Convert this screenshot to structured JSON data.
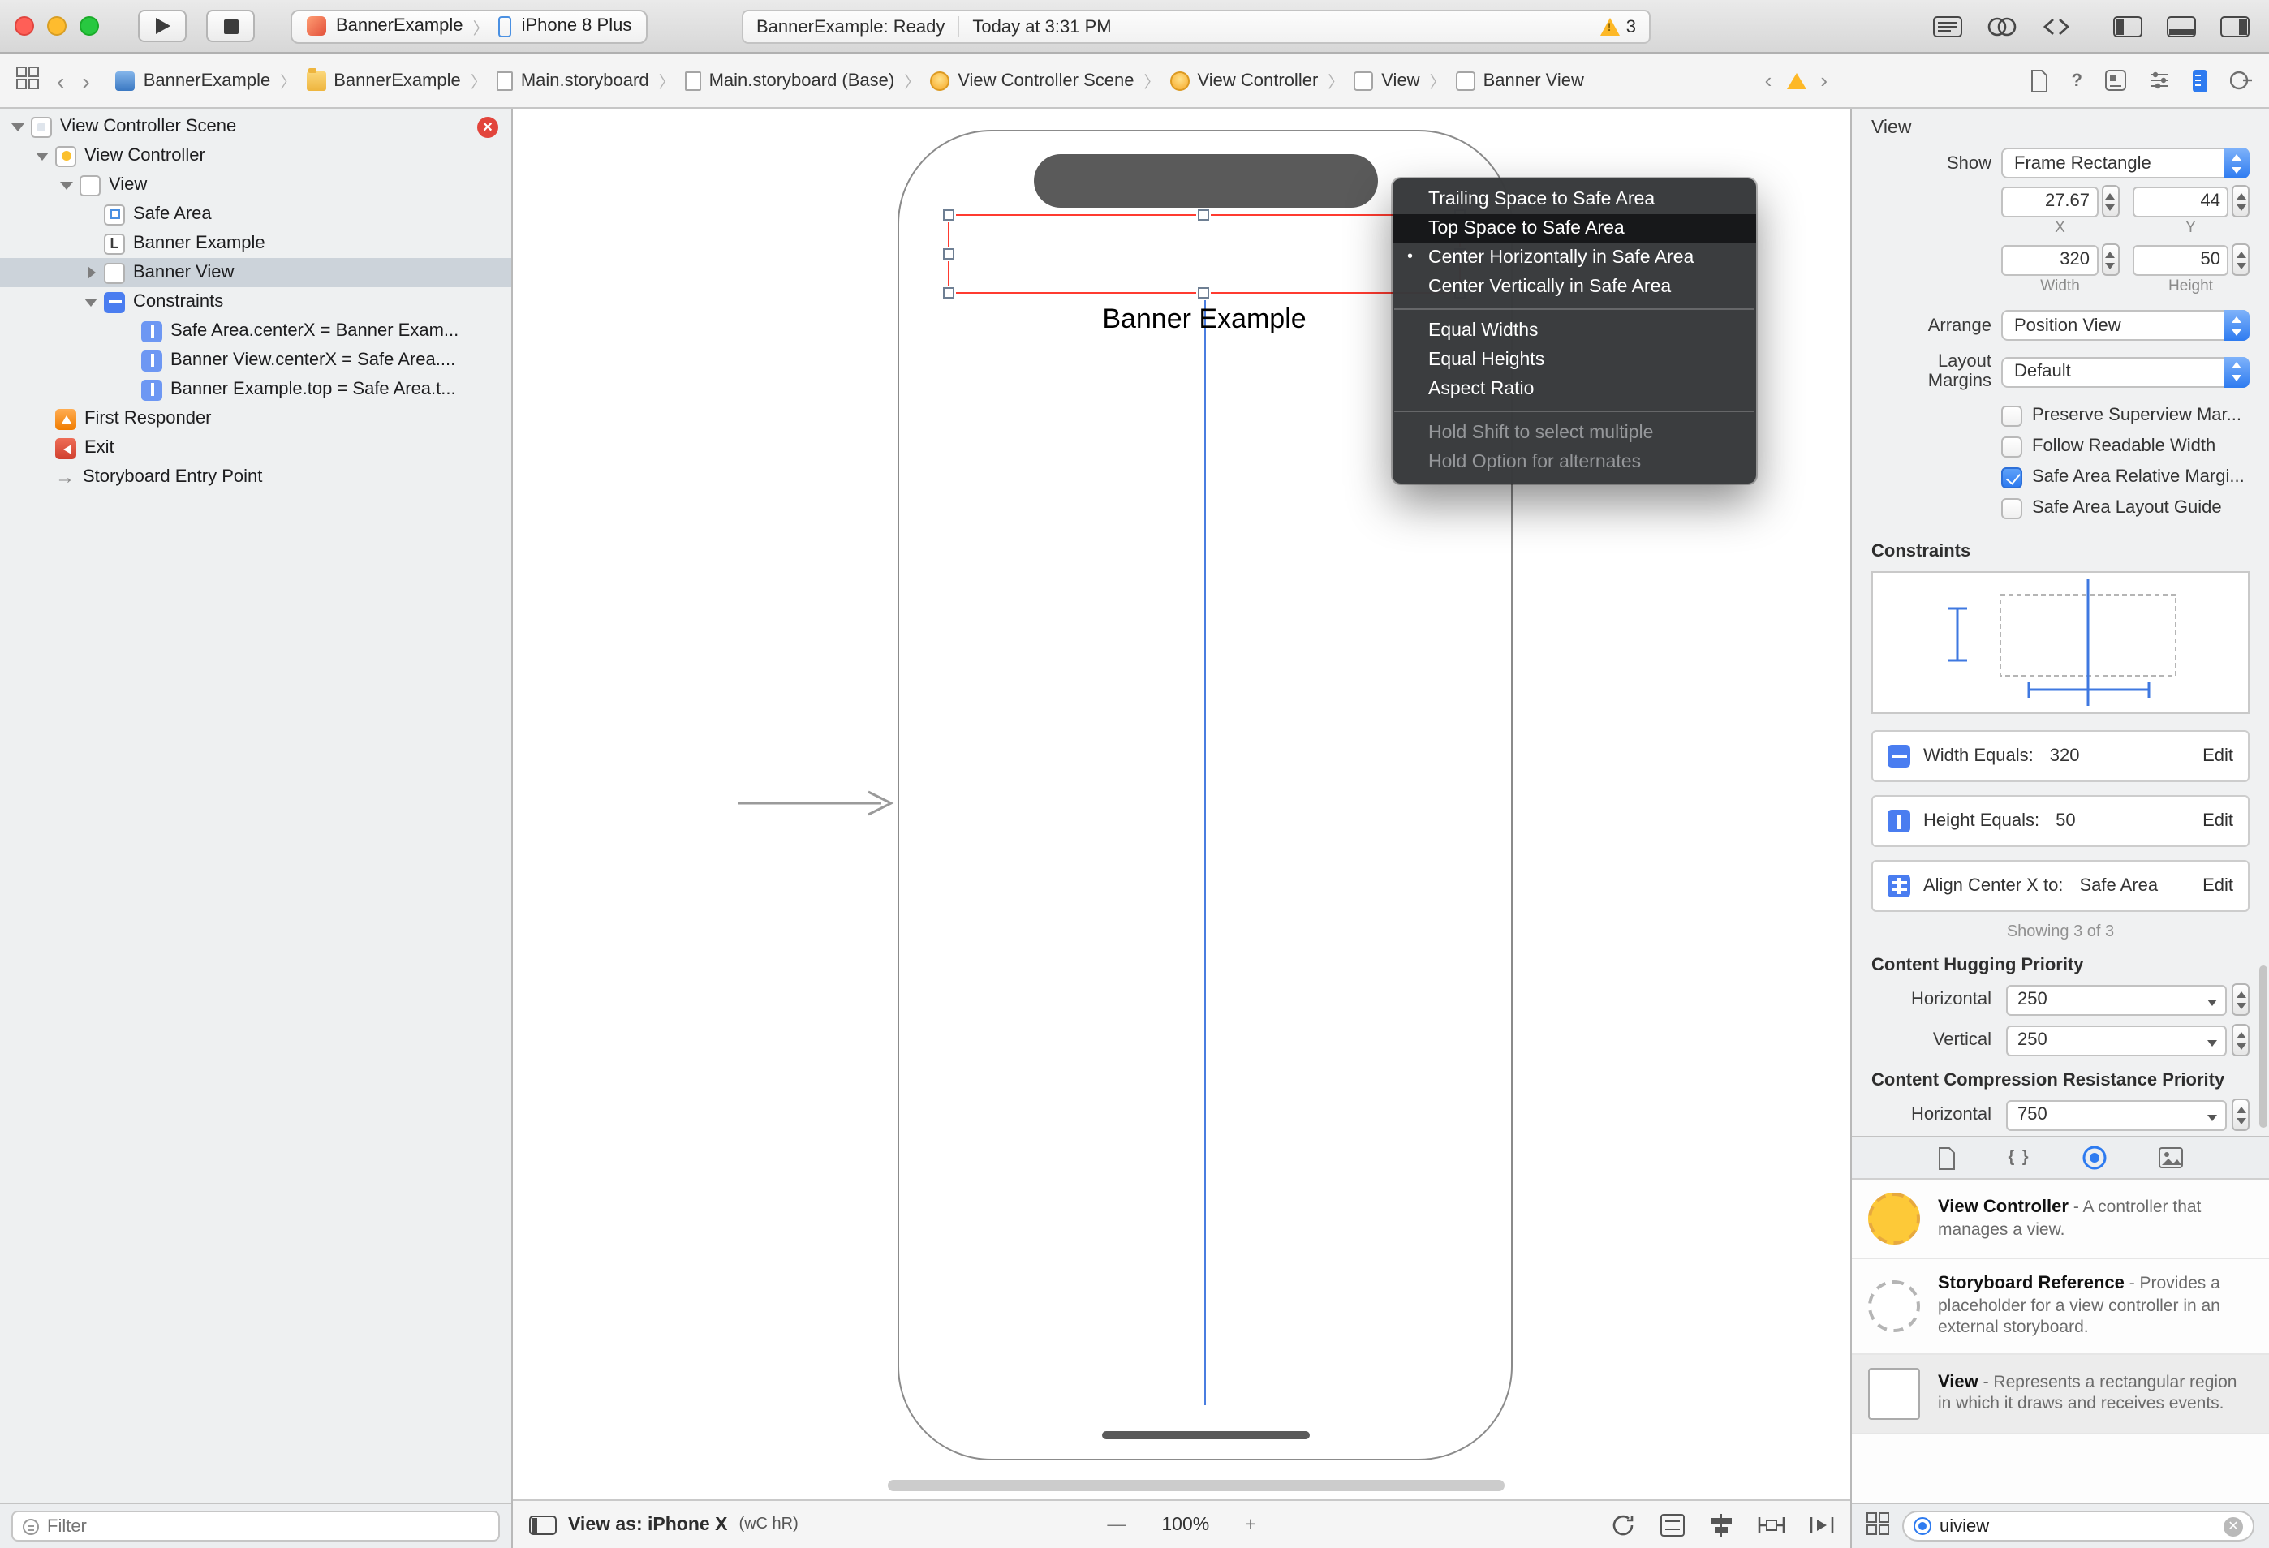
{
  "colors": {
    "accent_blue": "#2e7bf0",
    "selection_red": "#ff3b30",
    "warning_yellow": "#fdb827",
    "guide_blue": "#4a7de0",
    "constraint_icon_blue": "#4a7df0"
  },
  "titlebar": {
    "scheme": "BannerExample",
    "device": "iPhone 8 Plus",
    "status_project": "BannerExample: Ready",
    "status_time": "Today at 3:31 PM",
    "warning_count": "3"
  },
  "jumpbar": {
    "crumbs": [
      {
        "label": "BannerExample",
        "icon": "project-icon"
      },
      {
        "label": "BannerExample",
        "icon": "group-folder-icon"
      },
      {
        "label": "Main.storyboard",
        "icon": "storyboard-file-icon"
      },
      {
        "label": "Main.storyboard (Base)",
        "icon": "storyboard-file-icon"
      },
      {
        "label": "View Controller Scene",
        "icon": "view-controller-icon"
      },
      {
        "label": "View Controller",
        "icon": "view-controller-icon"
      },
      {
        "label": "View",
        "icon": "view-icon"
      },
      {
        "label": "Banner View",
        "icon": "view-icon"
      }
    ]
  },
  "navigator": {
    "items": [
      {
        "label": "View Controller Scene",
        "level": 0,
        "expanded": true,
        "has_error_badge": true
      },
      {
        "label": "View Controller",
        "level": 1,
        "expanded": true
      },
      {
        "label": "View",
        "level": 2,
        "expanded": true
      },
      {
        "label": "Safe Area",
        "level": 3
      },
      {
        "label": "Banner Example",
        "level": 3
      },
      {
        "label": "Banner View",
        "level": 3,
        "collapsed": true,
        "selected": true
      },
      {
        "label": "Constraints",
        "level": 3,
        "expanded": true
      },
      {
        "label": "Safe Area.centerX = Banner Exam...",
        "level": 4
      },
      {
        "label": "Banner View.centerX = Safe Area....",
        "level": 4
      },
      {
        "label": "Banner Example.top = Safe Area.t...",
        "level": 4
      },
      {
        "label": "First Responder",
        "level": 1
      },
      {
        "label": "Exit",
        "level": 1
      },
      {
        "label": "Storyboard Entry Point",
        "level": 1
      }
    ],
    "filter_placeholder": "Filter"
  },
  "canvas": {
    "banner_text": "Banner Example",
    "menu": {
      "items": [
        {
          "label": "Trailing Space to Safe Area",
          "state": "normal"
        },
        {
          "label": "Top Space to Safe Area",
          "state": "highlighted"
        },
        {
          "label": "Center Horizontally in Safe Area",
          "state": "checked"
        },
        {
          "label": "Center Vertically in Safe Area",
          "state": "normal"
        },
        {
          "label": "Equal Widths",
          "state": "normal"
        },
        {
          "label": "Equal Heights",
          "state": "normal"
        },
        {
          "label": "Aspect Ratio",
          "state": "normal"
        },
        {
          "label": "Hold Shift to select multiple",
          "state": "disabled"
        },
        {
          "label": "Hold Option for alternates",
          "state": "disabled"
        }
      ]
    },
    "bottombar": {
      "view_as_prefix": "View as: iPhone X",
      "view_as_traits": "(wC hR)",
      "zoom_out_label": "—",
      "zoom_value": "100%",
      "zoom_in_label": "+"
    }
  },
  "inspector": {
    "title": "View",
    "show_label": "Show",
    "show_value": "Frame Rectangle",
    "x_value": "27.67",
    "y_value": "44",
    "x_label": "X",
    "y_label": "Y",
    "width_value": "320",
    "height_value": "50",
    "width_label": "Width",
    "height_label": "Height",
    "arrange_label": "Arrange",
    "arrange_value": "Position View",
    "layout_margins_label": "Layout Margins",
    "layout_margins_value": "Default",
    "checkboxes": [
      {
        "label": "Preserve Superview Mar...",
        "checked": false
      },
      {
        "label": "Follow Readable Width",
        "checked": false
      },
      {
        "label": "Safe Area Relative Margi...",
        "checked": true
      },
      {
        "label": "Safe Area Layout Guide",
        "checked": false
      }
    ],
    "constraints_header": "Constraints",
    "constraints": [
      {
        "label": "Width Equals:",
        "value": "320",
        "edit": "Edit"
      },
      {
        "label": "Height Equals:",
        "value": "50",
        "edit": "Edit"
      },
      {
        "label": "Align Center X to:",
        "value": "Safe Area",
        "edit": "Edit"
      }
    ],
    "showing": "Showing 3 of 3",
    "hugging_header": "Content Hugging Priority",
    "hugging_rows": [
      {
        "label": "Horizontal",
        "value": "250"
      },
      {
        "label": "Vertical",
        "value": "250"
      }
    ],
    "compression_header": "Content Compression Resistance Priority",
    "compression_rows": [
      {
        "label": "Horizontal",
        "value": "750"
      }
    ],
    "library": [
      {
        "title": "View Controller",
        "desc": "- A controller that manages a view."
      },
      {
        "title": "Storyboard Reference",
        "desc": "- Provides a placeholder for a view controller in an external storyboard."
      },
      {
        "title": "View",
        "desc": "- Represents a rectangular region in which it draws and receives events."
      }
    ],
    "filter_value": "uiview"
  }
}
